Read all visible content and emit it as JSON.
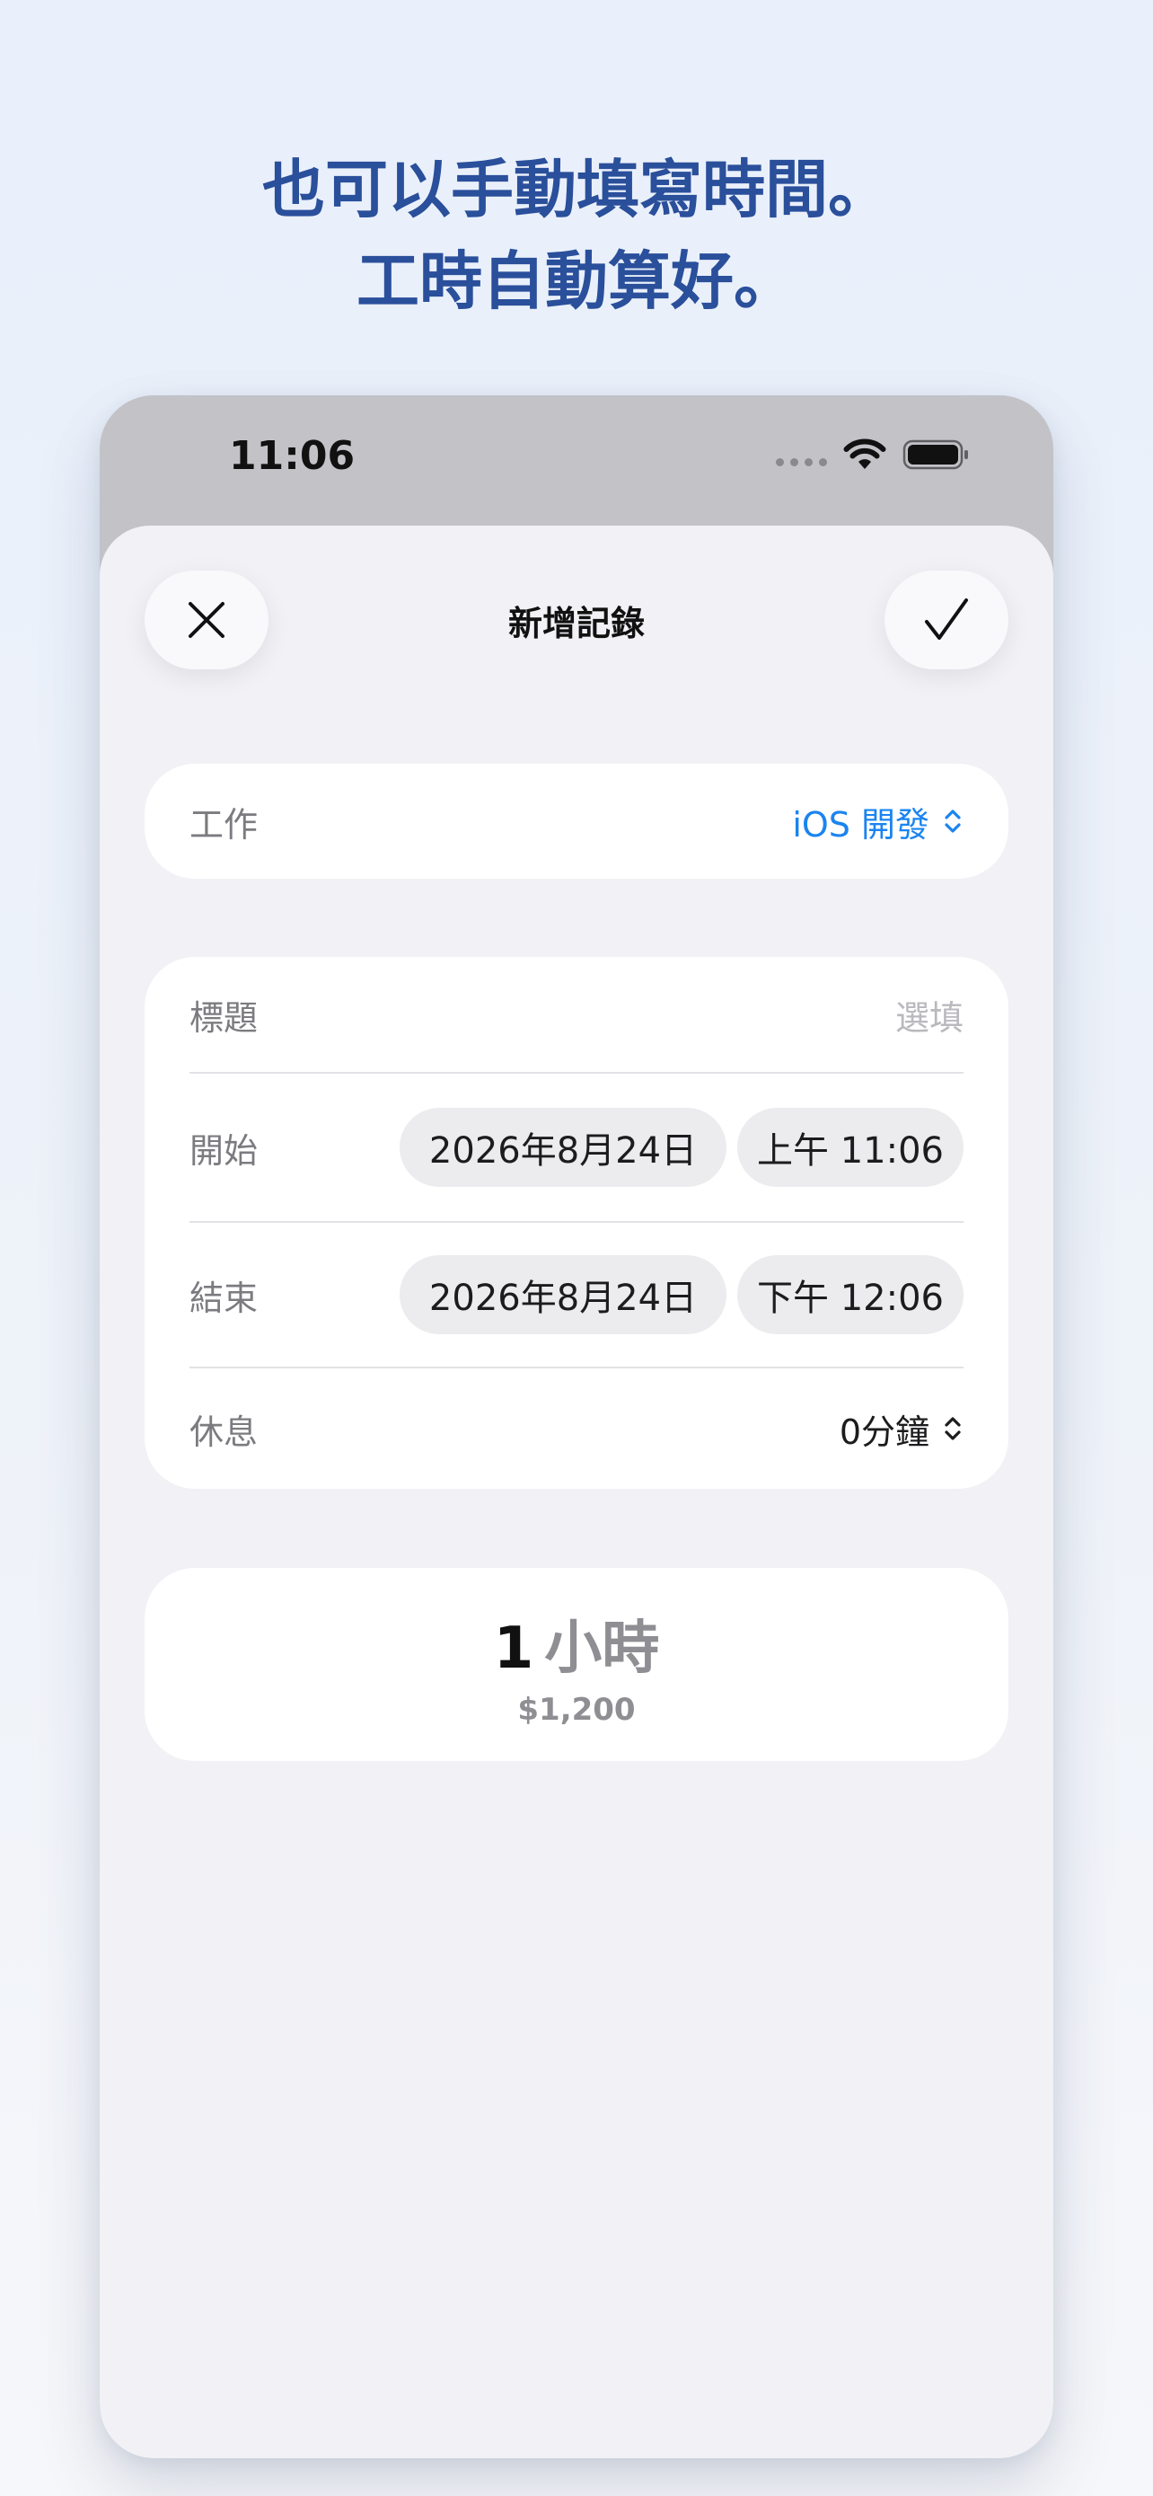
{
  "headline": {
    "line1": "也可以手動填寫時間。",
    "line2": "工時自動算好。"
  },
  "status_bar": {
    "time": "11:06",
    "icons": [
      "signal-dots-icon",
      "wifi-icon",
      "battery-icon"
    ]
  },
  "sheet": {
    "title": "新增記錄",
    "close_icon": "close-icon",
    "done_icon": "checkmark-icon"
  },
  "job": {
    "label": "工作",
    "value": "iOS 開發",
    "icon": "chevron-up-down-icon"
  },
  "fields": {
    "title_label": "標題",
    "title_placeholder": "選填",
    "start_label": "開始",
    "start_date": "2026年8月24日",
    "start_time": "上午 11:06",
    "end_label": "結束",
    "end_date": "2026年8月24日",
    "end_time": "下午 12:06",
    "break_label": "休息",
    "break_value": "0分鐘"
  },
  "total": {
    "hours_number": "1",
    "hours_unit": "小時",
    "pay": "$1,200"
  },
  "colors": {
    "headline": "#2a4f9b",
    "accent": "#1a84f0",
    "background": "#e9f0fb"
  }
}
